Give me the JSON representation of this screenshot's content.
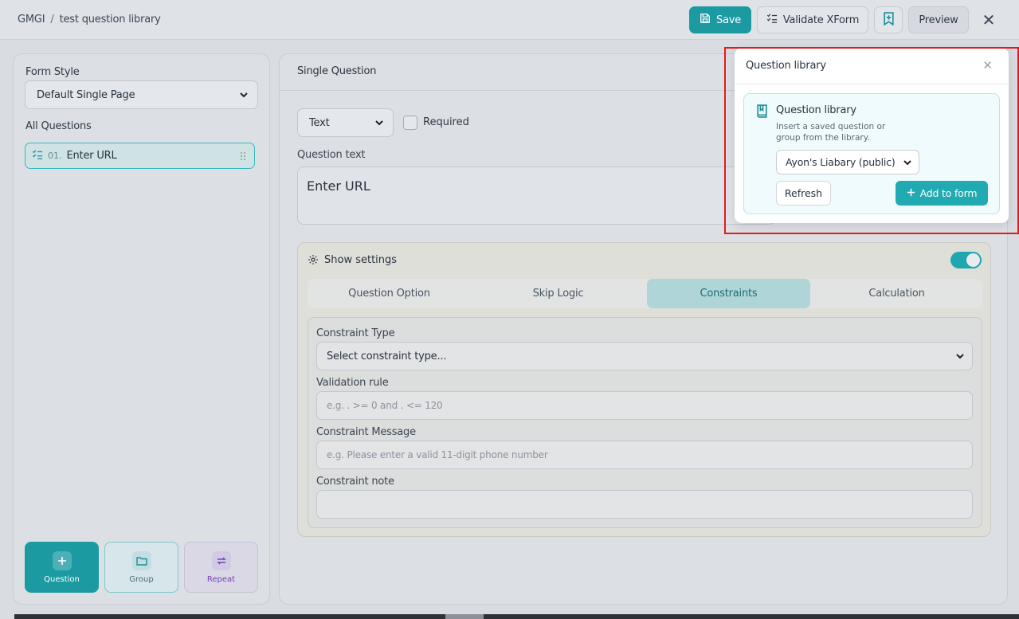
{
  "breadcrumb": {
    "org": "GMGI",
    "separator": "/",
    "project": "test question library"
  },
  "toolbar": {
    "save_label": "Save",
    "validate_label": "Validate XForm",
    "preview_label": "Preview",
    "close_symbol": "✕"
  },
  "sidebar": {
    "form_style_label": "Form Style",
    "form_style_value": "Default Single Page",
    "all_questions_label": "All Questions",
    "questions": [
      {
        "number": "01.",
        "label": "Enter URL"
      }
    ],
    "add_buttons": {
      "question": "Question",
      "group": "Group",
      "repeat": "Repeat"
    }
  },
  "editor": {
    "title": "Single Question",
    "type_value": "Text",
    "required_label": "Required",
    "question_text_label": "Question text",
    "question_text_value": "Enter URL",
    "show_settings_label": "Show settings",
    "show_settings_on": true,
    "tabs": [
      "Question Option",
      "Skip Logic",
      "Constraints",
      "Calculation"
    ],
    "active_tab": "Constraints",
    "constraint_type_label": "Constraint Type",
    "constraint_type_placeholder": "Select constraint type...",
    "validation_rule_label": "Validation rule",
    "validation_rule_placeholder": "e.g. . >= 0 and . <= 120",
    "constraint_message_label": "Constraint Message",
    "constraint_message_placeholder": "e.g. Please enter a valid 11-digit phone number",
    "constraint_note_label": "Constraint note",
    "constraint_note_value": ""
  },
  "library_popover": {
    "title": "Question library",
    "card_title": "Question library",
    "card_description": "Insert a saved question or group from the library.",
    "selected_library": "Ayon's Liabary (public)",
    "refresh_label": "Refresh",
    "add_label": "Add to form",
    "close_symbol": "✕"
  },
  "colors": {
    "accent": "#1b9aa2",
    "highlight": "#e31b1b"
  },
  "icons": [
    "save-icon",
    "checklist-icon",
    "bookmark-plus-icon",
    "close-icon",
    "chevron-down-icon",
    "drag-grip-icon",
    "plus-icon",
    "folder-icon",
    "repeat-icon",
    "gear-icon",
    "book-icon"
  ]
}
